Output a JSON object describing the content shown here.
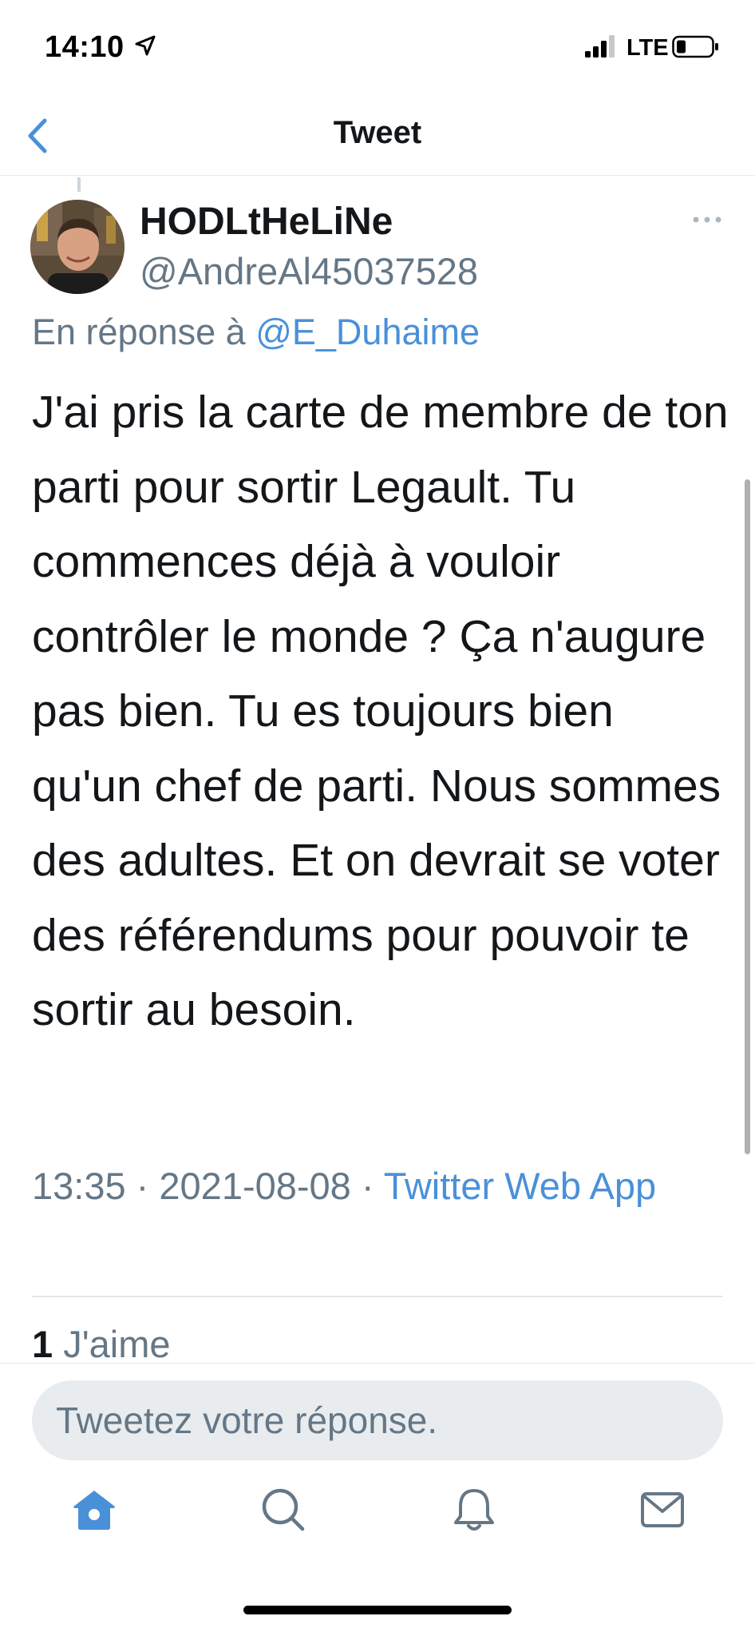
{
  "status_bar": {
    "time": "14:10",
    "network": "LTE"
  },
  "nav": {
    "title": "Tweet"
  },
  "tweet": {
    "display_name": "HODLtHeLiNe",
    "handle": "@AndreAl45037528",
    "reply_prefix": "En réponse à ",
    "reply_mention": "@E_Duhaime",
    "text": "J'ai pris la carte de membre de ton parti pour sortir Legault. Tu commences déjà à vouloir contrôler le monde ? Ça n'augure pas bien. Tu es toujours bien qu'un chef de parti. Nous sommes des adultes. Et on devrait se voter des référendums pour pouvoir te sortir au besoin.",
    "time": "13:35",
    "separator": " · ",
    "date": "2021-08-08",
    "source": "Twitter Web App",
    "likes_count": "1",
    "likes_label": " J'aime"
  },
  "reply_box": {
    "placeholder": "Tweetez votre réponse."
  },
  "tabs": [
    {
      "icon": "home-icon"
    },
    {
      "icon": "search-icon"
    },
    {
      "icon": "bell-icon"
    },
    {
      "icon": "mail-icon"
    }
  ],
  "colors": {
    "accent": "#4a90d9",
    "secondary_text": "#657786",
    "primary_text": "#14171a"
  }
}
